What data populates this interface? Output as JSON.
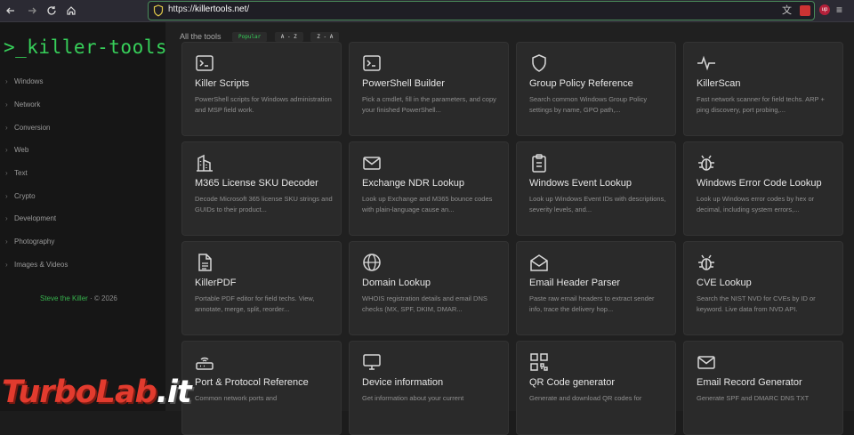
{
  "browser": {
    "url_prefix": "https://",
    "url_domain": "killertools.net",
    "url_suffix": "/",
    "badge": "up"
  },
  "sidebar": {
    "logo": ">_killer-tools",
    "items": [
      {
        "label": "Windows"
      },
      {
        "label": "Network"
      },
      {
        "label": "Conversion"
      },
      {
        "label": "Web"
      },
      {
        "label": "Text"
      },
      {
        "label": "Crypto"
      },
      {
        "label": "Development"
      },
      {
        "label": "Photography"
      },
      {
        "label": "Images & Videos"
      }
    ],
    "footer_author": "Steve the Killer",
    "footer_year": "· © 2026"
  },
  "main": {
    "title": "All the tools",
    "tabs": [
      {
        "label": "Popular"
      },
      {
        "label": "A - Z"
      },
      {
        "label": "Z - A"
      }
    ],
    "cards": [
      {
        "icon": "terminal-icon",
        "title": "Killer Scripts",
        "desc": "PowerShell scripts for Windows administration and MSP field work."
      },
      {
        "icon": "terminal-icon",
        "title": "PowerShell Builder",
        "desc": "Pick a cmdlet, fill in the parameters, and copy your finished PowerShell..."
      },
      {
        "icon": "shield-icon",
        "title": "Group Policy Reference",
        "desc": "Search common Windows Group Policy settings by name, GPO path,..."
      },
      {
        "icon": "pulse-icon",
        "title": "KillerScan",
        "desc": "Fast network scanner for field techs. ARP + ping discovery, port probing,..."
      },
      {
        "icon": "building-icon",
        "title": "M365 License SKU Decoder",
        "desc": "Decode Microsoft 365 license SKU strings and GUIDs to their product..."
      },
      {
        "icon": "mail-icon",
        "title": "Exchange NDR Lookup",
        "desc": "Look up Exchange and M365 bounce codes with plain-language cause an..."
      },
      {
        "icon": "clipboard-icon",
        "title": "Windows Event Lookup",
        "desc": "Look up Windows Event IDs with descriptions, severity levels, and..."
      },
      {
        "icon": "bug-icon",
        "title": "Windows Error Code Lookup",
        "desc": "Look up Windows error codes by hex or decimal, including system errors,..."
      },
      {
        "icon": "file-icon",
        "title": "KillerPDF",
        "desc": "Portable PDF editor for field techs. View, annotate, merge, split, reorder..."
      },
      {
        "icon": "globe-icon",
        "title": "Domain Lookup",
        "desc": "WHOIS registration details and email DNS checks (MX, SPF, DKIM, DMAR..."
      },
      {
        "icon": "envelope-open-icon",
        "title": "Email Header Parser",
        "desc": "Paste raw email headers to extract sender info, trace the delivery hop..."
      },
      {
        "icon": "bug-icon",
        "title": "CVE Lookup",
        "desc": "Search the NIST NVD for CVEs by ID or keyword. Live data from NVD API."
      },
      {
        "icon": "router-icon",
        "title": "Port & Protocol Reference",
        "desc": "Common network ports and"
      },
      {
        "icon": "monitor-icon",
        "title": "Device information",
        "desc": "Get information about your current"
      },
      {
        "icon": "qr-icon",
        "title": "QR Code generator",
        "desc": "Generate and download QR codes for"
      },
      {
        "icon": "mail-icon",
        "title": "Email Record Generator",
        "desc": "Generate SPF and DMARC DNS TXT"
      }
    ]
  },
  "watermark": {
    "part1": "TurboLab",
    "part2": ".it"
  }
}
